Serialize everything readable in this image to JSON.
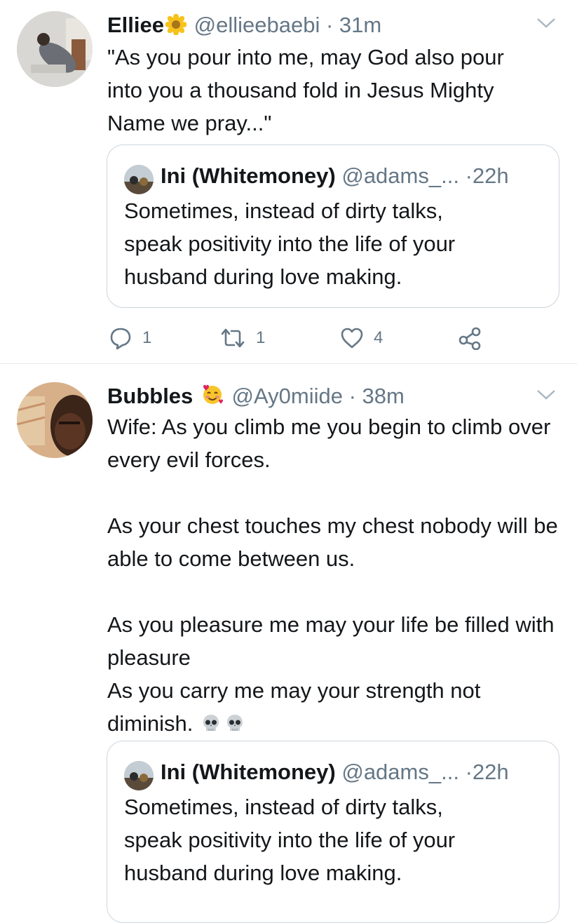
{
  "tweets": [
    {
      "display_name": "Elliee",
      "name_emoji": "sunflower-emoji",
      "handle": "@ellieebaebi",
      "time": "31m",
      "text_lines": [
        "\"As you pour into me, may God also pour",
        "into you a thousand fold in Jesus Mighty",
        "Name we pray...\""
      ],
      "quoted": {
        "display_name": "Ini (Whitemoney)",
        "handle": "@adams_...",
        "time": "22h",
        "text_lines": [
          "Sometimes, instead of dirty talks,",
          "speak positivity into the life of your",
          "husband during love making."
        ]
      },
      "actions": {
        "reply_count": "1",
        "retweet_count": "1",
        "like_count": "4"
      }
    },
    {
      "display_name": "Bubbles",
      "name_emoji": "smiling-face-with-hearts-emoji",
      "handle": "@Ay0miide",
      "time": "38m",
      "paragraphs": [
        "Wife: As you climb me you begin to climb over every evil forces.",
        "As your chest touches my chest nobody will be able to come between us.",
        "As you pleasure me may your life be filled with pleasure",
        "As you carry me may your strength not diminish."
      ],
      "trailing_emojis": [
        "skull-emoji",
        "skull-emoji"
      ],
      "quoted": {
        "display_name": "Ini (Whitemoney)",
        "handle": "@adams_...",
        "time": "22h",
        "text_lines": [
          "Sometimes, instead of dirty talks,",
          "speak positivity into the life of your",
          "husband during love making."
        ]
      }
    }
  ],
  "separator": "·",
  "colors": {
    "text": "#14171a",
    "secondary": "#657786",
    "border": "#ccd6dd",
    "divider": "#e6ecf0"
  }
}
